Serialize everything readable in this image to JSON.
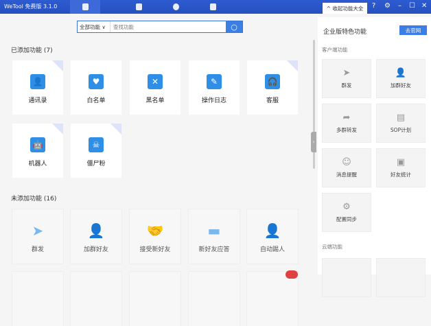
{
  "app": {
    "title": "WeTool 免费版 3.1.0"
  },
  "nav_tabs": [
    {
      "icon": "user-icon",
      "active": true
    },
    {
      "icon": "contact-card-icon"
    },
    {
      "icon": "skull-icon"
    },
    {
      "icon": "robot-icon"
    }
  ],
  "window": {
    "collapse_label": "^ 收起功能大全",
    "help": "?",
    "settings": "⚙",
    "minimize": "–",
    "maximize": "☐",
    "close": "✕"
  },
  "search": {
    "scope": "全部功能 ∨",
    "placeholder": "查找功能"
  },
  "added": {
    "heading": "已添加功能 (7)",
    "items": [
      {
        "label": "通讯录",
        "icon": "contacts-icon",
        "glyph": "👤"
      },
      {
        "label": "白名单",
        "icon": "whitelist-icon",
        "glyph": "♥"
      },
      {
        "label": "黑名单",
        "icon": "blacklist-icon",
        "glyph": "✕"
      },
      {
        "label": "操作日志",
        "icon": "log-icon",
        "glyph": "✎"
      },
      {
        "label": "客服",
        "icon": "customer-service-icon",
        "glyph": "🎧"
      },
      {
        "label": "机器人",
        "icon": "robot-icon",
        "glyph": "🤖"
      },
      {
        "label": "僵尸粉",
        "icon": "skull-icon",
        "glyph": "☠"
      }
    ]
  },
  "not_added": {
    "heading": "未添加功能 (16)",
    "items": [
      {
        "label": "群发",
        "icon": "send-icon",
        "glyph": "➤"
      },
      {
        "label": "加群好友",
        "icon": "add-friend-icon",
        "glyph": "👤"
      },
      {
        "label": "接受新好友",
        "icon": "handshake-icon",
        "glyph": "🤝"
      },
      {
        "label": "新好友应答",
        "icon": "message-icon",
        "glyph": "▬"
      },
      {
        "label": "自动踢人",
        "icon": "remove-user-icon",
        "glyph": "👤"
      }
    ]
  },
  "panel": {
    "title": "企业版特色功能",
    "button": "去官网",
    "client_heading": "客户端功能",
    "client_items": [
      {
        "label": "群发",
        "icon": "send-icon",
        "glyph": "➤"
      },
      {
        "label": "加群好友",
        "icon": "add-friend-icon",
        "glyph": "👤"
      },
      {
        "label": "多群转发",
        "icon": "forward-icon",
        "glyph": "➦"
      },
      {
        "label": "SOP计划",
        "icon": "plan-icon",
        "glyph": "▤"
      },
      {
        "label": "消息提醒",
        "icon": "customer-service-icon",
        "glyph": "☺"
      },
      {
        "label": "好友统计",
        "icon": "contact-card-icon",
        "glyph": "▣"
      },
      {
        "label": "配置同步",
        "icon": "gear-icon",
        "glyph": "⚙"
      }
    ],
    "cloud_heading": "云端功能"
  }
}
